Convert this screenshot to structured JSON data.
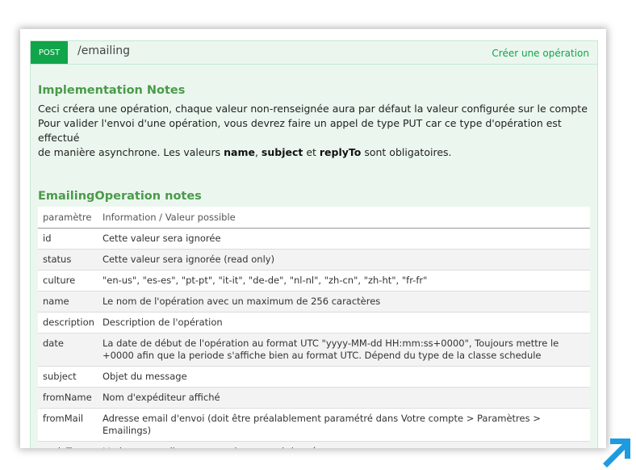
{
  "operation": {
    "method": "POST",
    "path": "/emailing",
    "summary": "Créer une opération"
  },
  "implementation": {
    "title": "Implementation Notes",
    "line1": "Ceci créera une opération, chaque valeur non-renseignée aura par défaut la valeur configurée sur le compte",
    "line2": "Pour valider l'envoi d'une opération, vous devrez faire un appel de type PUT car ce type d'opération est effectué",
    "line3_prefix": "de manière asynchrone. Les valeurs ",
    "bold1": "name",
    "sep1": ", ",
    "bold2": "subject",
    "sep2": " et ",
    "bold3": "replyTo",
    "line3_suffix": " sont obligatoires."
  },
  "emailing_notes": {
    "title": "EmailingOperation notes",
    "header": {
      "param": "paramètre",
      "info": "Information / Valeur possible"
    },
    "rows": [
      {
        "param": "id",
        "info": "Cette valeur sera ignorée"
      },
      {
        "param": "status",
        "info": "Cette valeur sera ignorée (read only)"
      },
      {
        "param": "culture",
        "info": "\"en-us\", \"es-es\", \"pt-pt\", \"it-it\", \"de-de\", \"nl-nl\", \"zh-cn\", \"zh-ht\", \"fr-fr\""
      },
      {
        "param": "name",
        "info": "Le nom de l'opération avec un maximum de 256 caractères"
      },
      {
        "param": "description",
        "info": "Description de l'opération"
      },
      {
        "param": "date",
        "info": "La date de début de l'opération au format UTC \"yyyy-MM-dd HH:mm:ss+0000\", Toujours mettre le +0000 afin que la periode s'affiche bien au format UTC. Dépend du type de la classe schedule"
      },
      {
        "param": "subject",
        "info": "Objet du message"
      },
      {
        "param": "fromName",
        "info": "Nom d'expéditeur affiché"
      },
      {
        "param": "fromMail",
        "info": "Adresse email d'envoi (doit être préalablement paramétré dans Votre compte > Paramètres > Emailings)"
      },
      {
        "param": "replyTo",
        "info": "L'adresse email ou vous voulez recevoir les réponses"
      }
    ]
  },
  "colors": {
    "method_bg": "#10a54a",
    "panel_bg": "#ebf7ee",
    "heading": "#4a9a4a",
    "arrow": "#1e9be0"
  },
  "icons": {
    "corner": "arrow-up-right-icon"
  }
}
